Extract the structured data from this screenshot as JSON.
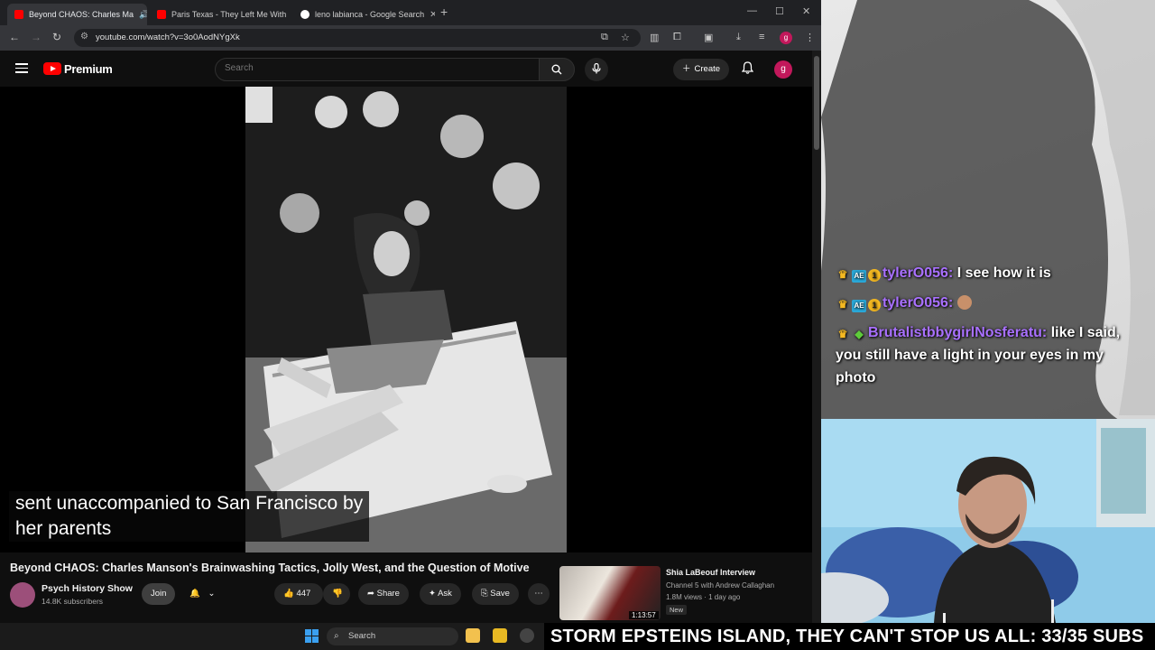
{
  "browser": {
    "tabs": [
      {
        "label": "Beyond CHAOS: Charles Ma",
        "active": true
      },
      {
        "label": "Paris Texas - They Left Me With",
        "active": false
      },
      {
        "label": "leno labianca - Google Search",
        "active": false
      }
    ],
    "url": "youtube.com/watch?v=3o0AodNYgXk",
    "profile_initial": "g"
  },
  "youtube": {
    "brand": "Premium",
    "search_placeholder": "Search",
    "create_label": "Create",
    "avatar_initial": "g",
    "caption_line1": "sent unaccompanied to San Francisco by",
    "caption_line2": "her parents",
    "video_title": "Beyond CHAOS: Charles Manson's Brainwashing Tactics, Jolly West, and the Question of Motive",
    "channel_name": "Psych History Show",
    "channel_subs": "14.8K subscribers",
    "join_label": "Join",
    "like_count": "447",
    "share_label": "Share",
    "ask_label": "Ask",
    "save_label": "Save",
    "recommended": {
      "title": "Shia LaBeouf Interview",
      "channel": "Channel 5 with Andrew Callaghan",
      "meta": "1.8M views · 1 day ago",
      "badge": "New",
      "duration": "1:13:57"
    }
  },
  "taskbar": {
    "search_label": "Search"
  },
  "stream": {
    "ticker": "STORM EPSTEINS ISLAND, THEY CAN'T STOP US ALL: 33/35 SUBS",
    "chat": [
      {
        "user": "tylerO056:",
        "message": "I see how it is"
      },
      {
        "user": "tylerO056:",
        "message": ""
      },
      {
        "user": "BrutalistbbygirlNosferatu:",
        "message": "like I said, you still have a light in your eyes in my photo"
      }
    ]
  },
  "colors": {
    "youtube_red": "#ff0000",
    "chat_username": "#a970ff",
    "avatar_pink": "#c2185b"
  }
}
